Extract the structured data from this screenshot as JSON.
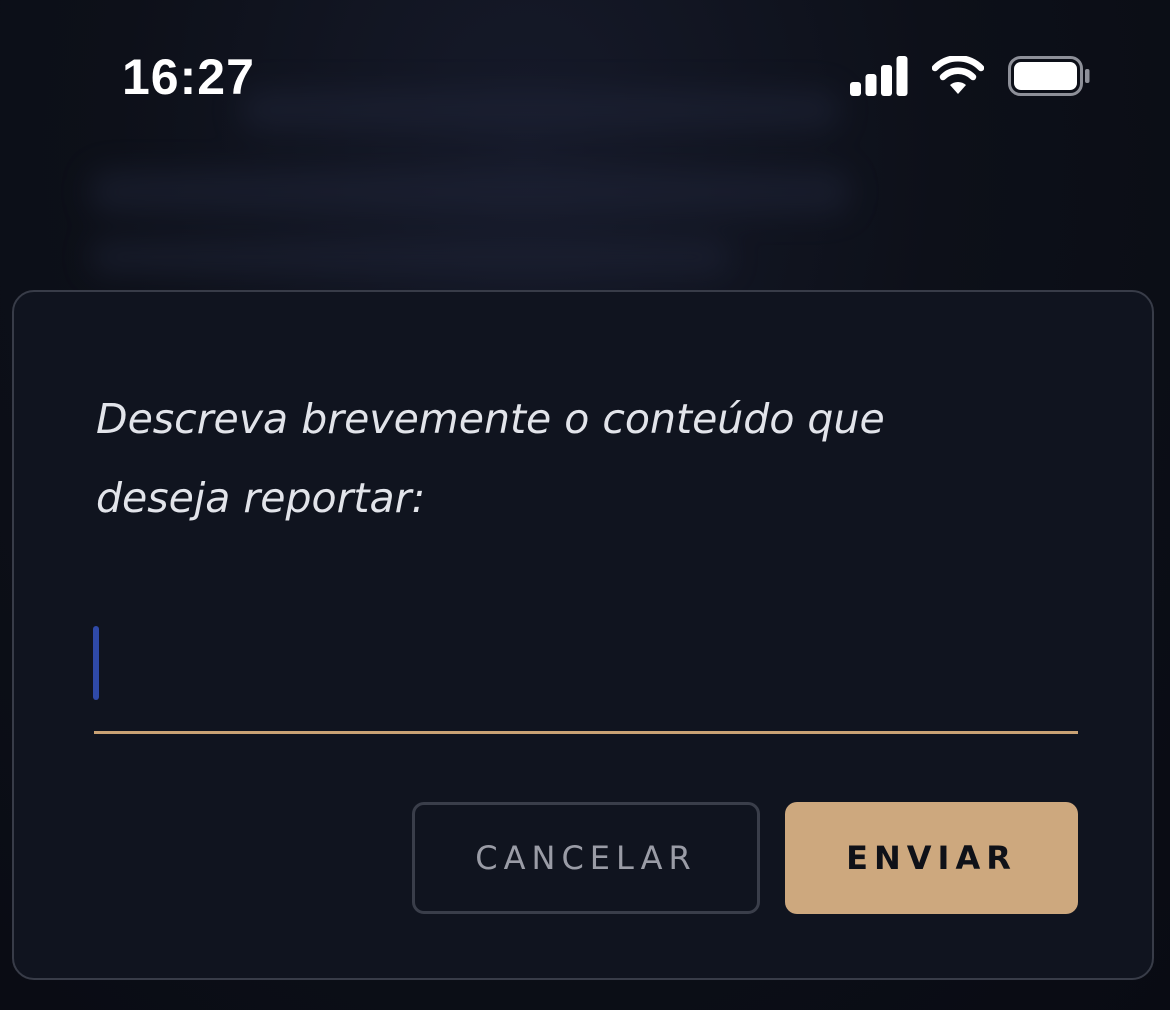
{
  "status_bar": {
    "time": "16:27",
    "icons": [
      "cellular-signal-icon",
      "wifi-icon",
      "battery-icon"
    ]
  },
  "dialog": {
    "prompt": "Descreva brevemente o conteúdo que deseja reportar:",
    "input": {
      "value": "",
      "placeholder": ""
    },
    "cancel_label": "CANCELAR",
    "send_label": "ENVIAR"
  },
  "colors": {
    "background": "#0a0c16",
    "dialog_background": "#10141f",
    "dialog_border": "#383c48",
    "accent": "#cda87e",
    "input_underline": "#c9a274",
    "cursor": "#2f4aa8",
    "text_primary": "#e2e4ea",
    "text_muted": "#9a9ca6"
  }
}
